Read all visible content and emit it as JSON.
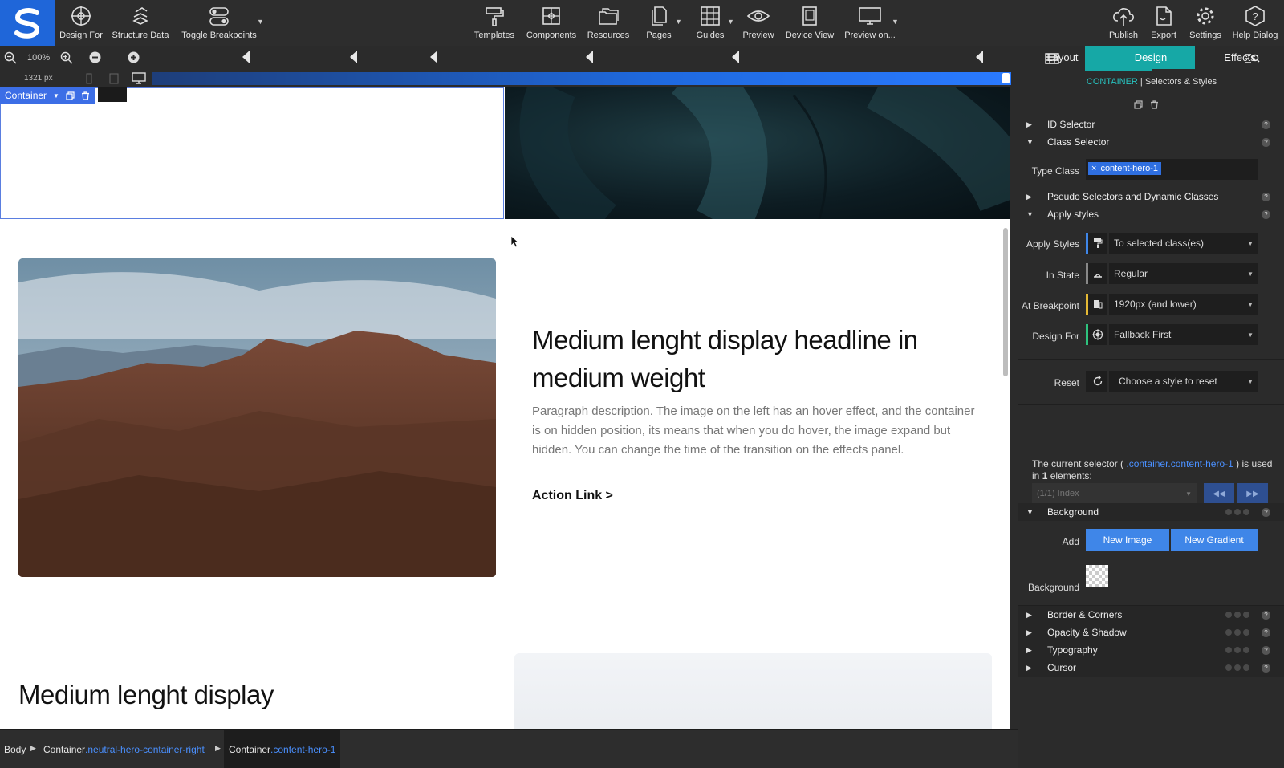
{
  "toolbar": {
    "items": [
      {
        "label": "Design For",
        "icon": "crosshair-icon"
      },
      {
        "label": "Structure Data",
        "icon": "structure-data-icon"
      },
      {
        "label": "Toggle Breakpoints",
        "icon": "toggle-icon"
      },
      {
        "label": "Templates",
        "icon": "paint-roller-icon"
      },
      {
        "label": "Components",
        "icon": "components-icon"
      },
      {
        "label": "Resources",
        "icon": "folder-icon"
      },
      {
        "label": "Pages",
        "icon": "pages-icon"
      },
      {
        "label": "Guides",
        "icon": "grid-icon"
      },
      {
        "label": "Preview",
        "icon": "eye-icon"
      },
      {
        "label": "Device View",
        "icon": "device-icon"
      },
      {
        "label": "Preview on...",
        "icon": "monitor-icon"
      },
      {
        "label": "Publish",
        "icon": "cloud-upload-icon"
      },
      {
        "label": "Export",
        "icon": "export-file-icon"
      },
      {
        "label": "Settings",
        "icon": "gear-icon"
      },
      {
        "label": "Help Dialog",
        "icon": "help-icon"
      }
    ]
  },
  "zoom": {
    "value": "100%"
  },
  "breakpoint": {
    "width": "1321 px"
  },
  "canvas": {
    "selected_tag": "Container",
    "headline": "Medium lenght display headline in medium weight",
    "paragraph": "Paragraph description. The image on the left has an hover effect, and the container is on hidden position, its means that when you do hover, the image expand but hidden. You can change the time of the transition on the effects panel.",
    "action_link": "Action Link >",
    "headline2": "Medium lenght display"
  },
  "breadcrumb": [
    {
      "tag": "Body",
      "cls": ""
    },
    {
      "tag": "Container",
      "cls": ".neutral-hero-container-right"
    },
    {
      "tag": "Container",
      "cls": ".content-hero-1"
    }
  ],
  "panel": {
    "header_accent": "CONTAINER",
    "header_rest": " | Selectors & Styles",
    "sections": {
      "id_selector": "ID Selector",
      "class_selector": "Class Selector",
      "pseudo": "Pseudo Selectors and Dynamic Classes",
      "apply_styles": "Apply styles",
      "background": "Background",
      "border": "Border & Corners",
      "opacity": "Opacity & Shadow",
      "typography": "Typography",
      "cursor": "Cursor"
    },
    "type_class_label": "Type Class",
    "class_chip": "content-hero-1",
    "rows": {
      "apply_styles": {
        "label": "Apply Styles",
        "value": "To selected class(es)"
      },
      "in_state": {
        "label": "In State",
        "value": "Regular"
      },
      "at_breakpoint": {
        "label": "At Breakpoint",
        "value": "1920px (and lower)"
      },
      "design_for": {
        "label": "Design For",
        "value": "Fallback First"
      },
      "reset": {
        "label": "Reset",
        "value": "Choose a style to reset"
      }
    },
    "info": {
      "prefix": "The current selector ( ",
      "selector": ".container.content-hero-1",
      "middle": " ) is used in ",
      "count": "1",
      "suffix": " elements:"
    },
    "index_value": "(1/1) Index",
    "design_tabs": {
      "layout": "Layout",
      "design": "Design",
      "effects": "Effects"
    },
    "add_label": "Add",
    "new_image": "New Image",
    "new_gradient": "New Gradient",
    "background_label": "Background"
  },
  "colors": {
    "accent_teal": "#16a8a6",
    "brand_blue": "#1f66d9",
    "link_blue": "#4a90ff"
  }
}
